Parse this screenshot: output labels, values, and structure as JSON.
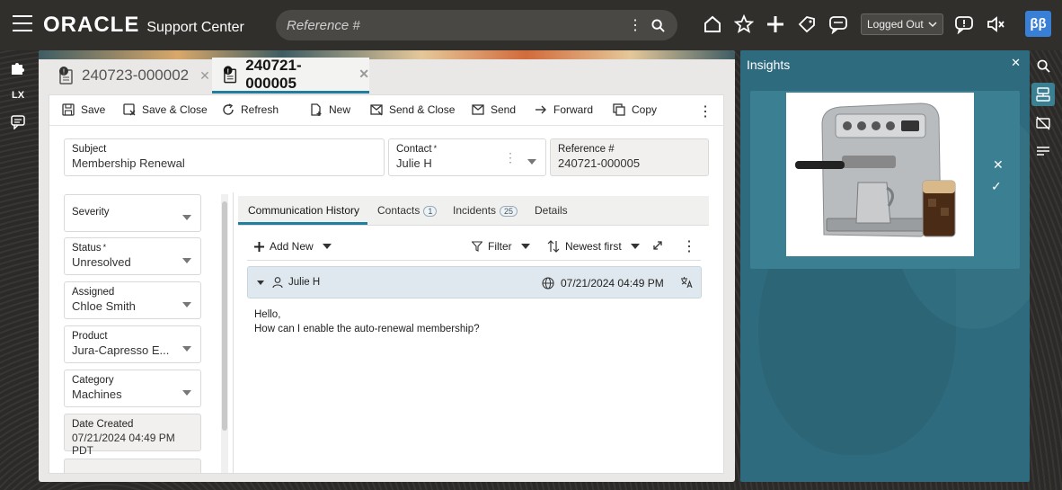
{
  "app": {
    "brand": "ORACLE",
    "product": "Support Center",
    "search_placeholder": "Reference #",
    "status": "Logged Out",
    "avatar_initials": "ββ"
  },
  "left_rail": {
    "lx_label": "LX"
  },
  "work_tabs": [
    {
      "label": "240723-000002",
      "active": false
    },
    {
      "label": "240721-000005",
      "active": true
    }
  ],
  "toolbar": {
    "save": "Save",
    "save_close": "Save & Close",
    "refresh": "Refresh",
    "new": "New",
    "send_close": "Send & Close",
    "send": "Send",
    "forward": "Forward",
    "copy": "Copy"
  },
  "header_fields": {
    "subject_label": "Subject",
    "subject_value": "Membership Renewal",
    "contact_label": "Contact",
    "contact_value": "Julie H",
    "reference_label": "Reference #",
    "reference_value": "240721-000005"
  },
  "side_fields": [
    {
      "label": "Severity",
      "value": ""
    },
    {
      "label": "Status",
      "value": "Unresolved",
      "required": true
    },
    {
      "label": "Assigned",
      "value": "Chloe Smith"
    },
    {
      "label": "Product",
      "value": "Jura-Capresso E..."
    },
    {
      "label": "Category",
      "value": "Machines"
    },
    {
      "label": "Date Created",
      "value": "07/21/2024 04:49 PM PDT"
    }
  ],
  "sub_tabs": [
    {
      "label": "Communication History",
      "badge": ""
    },
    {
      "label": "Contacts",
      "badge": "1"
    },
    {
      "label": "Incidents",
      "badge": "25"
    },
    {
      "label": "Details",
      "badge": ""
    }
  ],
  "list_toolbar": {
    "add_new": "Add New",
    "filter": "Filter",
    "sort": "Newest first"
  },
  "message": {
    "author": "Julie H",
    "timestamp": "07/21/2024 04:49 PM",
    "line1": "Hello,",
    "line2": "How can I enable the auto-renewal membership?"
  },
  "insights": {
    "title": "Insights"
  }
}
